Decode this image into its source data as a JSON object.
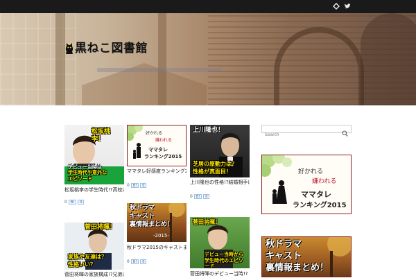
{
  "site": {
    "title": "黒ねこ図書館"
  },
  "topbar": {
    "social": [
      {
        "icon": "feedly-icon"
      },
      {
        "icon": "twitter-icon"
      }
    ]
  },
  "posts": [
    {
      "thumb_caption_lines": [
        "松坂桃李！",
        "デビュー当時は",
        "学生時代や意外な",
        "エピソード"
      ],
      "title": "松坂桃李の学生時代!?高校は？",
      "excerpt": "",
      "share": {
        "comments": "0",
        "hatena": "B!",
        "likes": "0"
      }
    },
    {
      "thumb_caption_lines": [
        "好かれる",
        "嫌われる",
        "ママタレ",
        "ランキング2015"
      ],
      "title": "ママタレ好感度ランキング2015!?",
      "excerpt": "",
      "share": {
        "comments": "0",
        "hatena": "B!",
        "likes": "0"
      }
    },
    {
      "thumb_caption_lines": [
        "上川隆也！",
        "芝居の原動力は？",
        "性格が真面目！"
      ],
      "title": "上川隆也の性格!?結婚相手は？",
      "excerpt": "",
      "share": {
        "comments": "0",
        "hatena": "B!",
        "likes": "0"
      }
    },
    {
      "thumb_caption_lines": [
        "菅田将暉！",
        "家族や友達は？",
        "性格いい？"
      ],
      "title": "菅田将暉の家族構成!?兄弟は？",
      "excerpt": "",
      "share": {
        "comments": "0",
        "hatena": "B!",
        "likes": "0"
      }
    },
    {
      "thumb_caption_lines": [
        "秋ドラマ",
        "キャスト",
        "裏情報まとめ！",
        "-2015-"
      ],
      "title": "秋ドラマ2015のキャストまとめ!?",
      "excerpt": "",
      "share": {
        "comments": "0",
        "hatena": "B!",
        "likes": "0"
      }
    },
    {
      "thumb_caption_lines": [
        "菅田将暉！",
        "デビュー当時から",
        "学生時代のエピソード"
      ],
      "title": "菅田将暉のデビュー当時!?",
      "excerpt": "",
      "share": {
        "comments": "0",
        "hatena": "B!",
        "likes": "0"
      }
    }
  ],
  "sidebar": {
    "search_placeholder": "Search",
    "widget1_title": "",
    "widget1_caption_lines": [
      "好かれる",
      "嫌われる",
      "ママタレ",
      "ランキング2015"
    ],
    "widget2_title": "",
    "widget2_caption_lines": [
      "秋ドラマ",
      "キャスト",
      "裏情報まとめ！"
    ]
  },
  "colors": {
    "topbar": "#1a1a1a",
    "accent_red": "#8a1f1f",
    "badge_yellow": "#ffe800",
    "share_blue": "#3b6aa0"
  }
}
